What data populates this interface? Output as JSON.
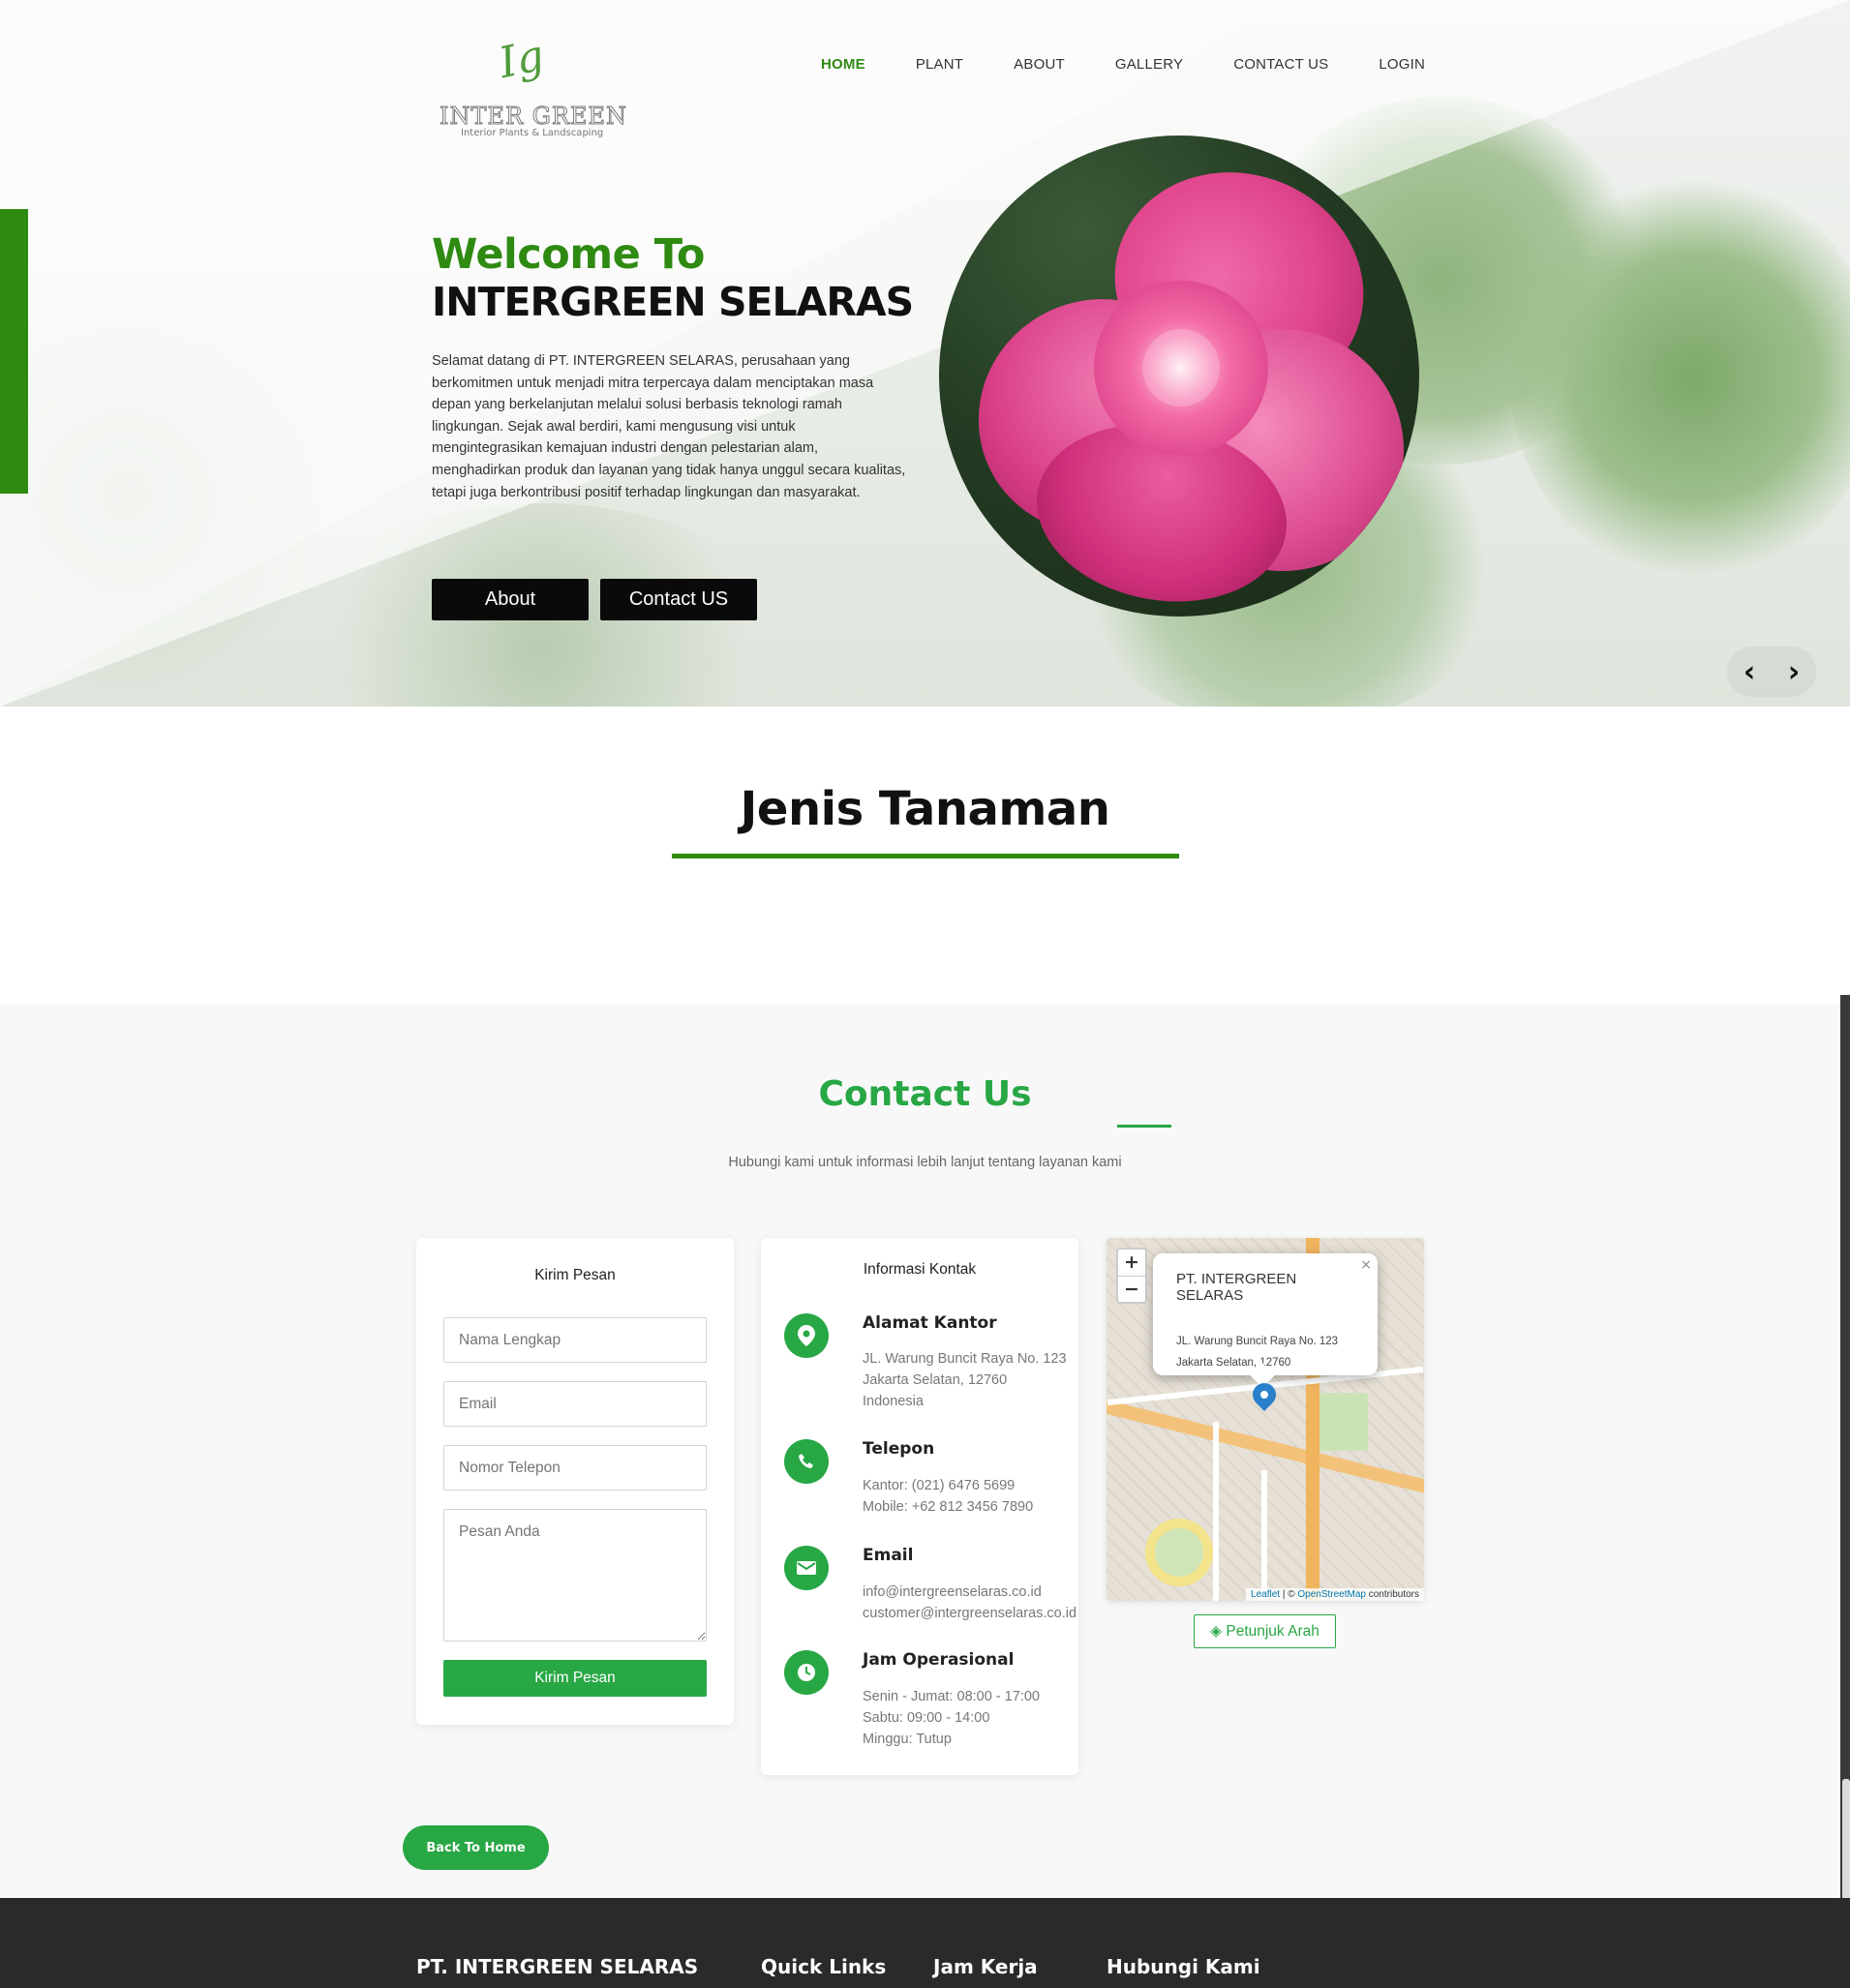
{
  "brand": {
    "logo_script": "Ig",
    "logo_name": "INTER GREEN",
    "logo_tagline": "Interior Plants & Landscaping"
  },
  "nav": {
    "items": [
      {
        "label": "HOME",
        "active": true
      },
      {
        "label": "PLANT",
        "active": false
      },
      {
        "label": "ABOUT",
        "active": false
      },
      {
        "label": "GALLERY",
        "active": false
      },
      {
        "label": "CONTACT US",
        "active": false
      },
      {
        "label": "LOGIN",
        "active": false
      }
    ]
  },
  "hero": {
    "title_line1": "Welcome To",
    "title_line2": "INTERGREEN SELARAS",
    "text": "Selamat datang di PT. INTERGREEN SELARAS, perusahaan yang berkomitmen untuk menjadi mitra terpercaya dalam menciptakan masa depan yang berkelanjutan melalui solusi berbasis teknologi ramah lingkungan. Sejak awal berdiri, kami mengusung visi untuk mengintegrasikan kemajuan industri dengan pelestarian alam, menghadirkan produk dan layanan yang tidak hanya unggul secara kualitas, tetapi juga berkontribusi positif terhadap lingkungan dan masyarakat.",
    "btn_about": "About",
    "btn_contact": "Contact US",
    "prev_icon": "‹",
    "next_icon": "›"
  },
  "plants": {
    "title": "Jenis Tanaman"
  },
  "contact": {
    "title": "Contact Us",
    "subtitle": "Hubungi kami untuk informasi lebih lanjut tentang layanan kami",
    "form": {
      "heading": "Kirim Pesan",
      "name_placeholder": "Nama Lengkap",
      "email_placeholder": "Email",
      "phone_placeholder": "Nomor Telepon",
      "message_placeholder": "Pesan Anda",
      "submit": "Kirim Pesan"
    },
    "info": {
      "heading": "Informasi Kontak",
      "address": {
        "title": "Alamat Kantor",
        "lines": [
          "JL. Warung Buncit Raya No. 123",
          "Jakarta Selatan, 12760",
          "Indonesia"
        ]
      },
      "phone": {
        "title": "Telepon",
        "lines": [
          "Kantor: (021) 6476 5699",
          "Mobile: +62 812 3456 7890"
        ]
      },
      "email": {
        "title": "Email",
        "lines": [
          "info@intergreenselaras.co.id",
          "customer@intergreenselaras.co.id"
        ]
      },
      "hours": {
        "title": "Jam Operasional",
        "lines": [
          "Senin - Jumat: 08:00 - 17:00",
          "Sabtu: 09:00 - 14:00",
          "Minggu: Tutup"
        ]
      }
    },
    "map": {
      "zoom_in": "+",
      "zoom_out": "−",
      "popup_title": "PT. INTERGREEN SELARAS",
      "popup_address_1": "JL. Warung Buncit Raya No. 123",
      "popup_address_2": "Jakarta Selatan, 12760",
      "popup_close": "×",
      "attribution_leaflet": "Leaflet",
      "attribution_sep": " | © ",
      "attribution_osm": "OpenStreetMap",
      "attribution_tail": " contributors"
    },
    "directions": "Petunjuk Arah",
    "back_home": "Back To Home"
  },
  "footer": {
    "col1": "PT. INTERGREEN SELARAS",
    "col2": "Quick Links",
    "col3": "Jam Kerja",
    "col4": "Hubungi Kami"
  },
  "colors": {
    "brand_green": "#2f8a12",
    "accent_green": "#28a745",
    "dark": "#0a0a0a",
    "footer_bg": "#2a2a2a"
  },
  "icons": {
    "address": "map-pin-icon",
    "phone": "phone-icon",
    "email": "envelope-icon",
    "hours": "clock-icon",
    "directions": "directions-icon"
  }
}
